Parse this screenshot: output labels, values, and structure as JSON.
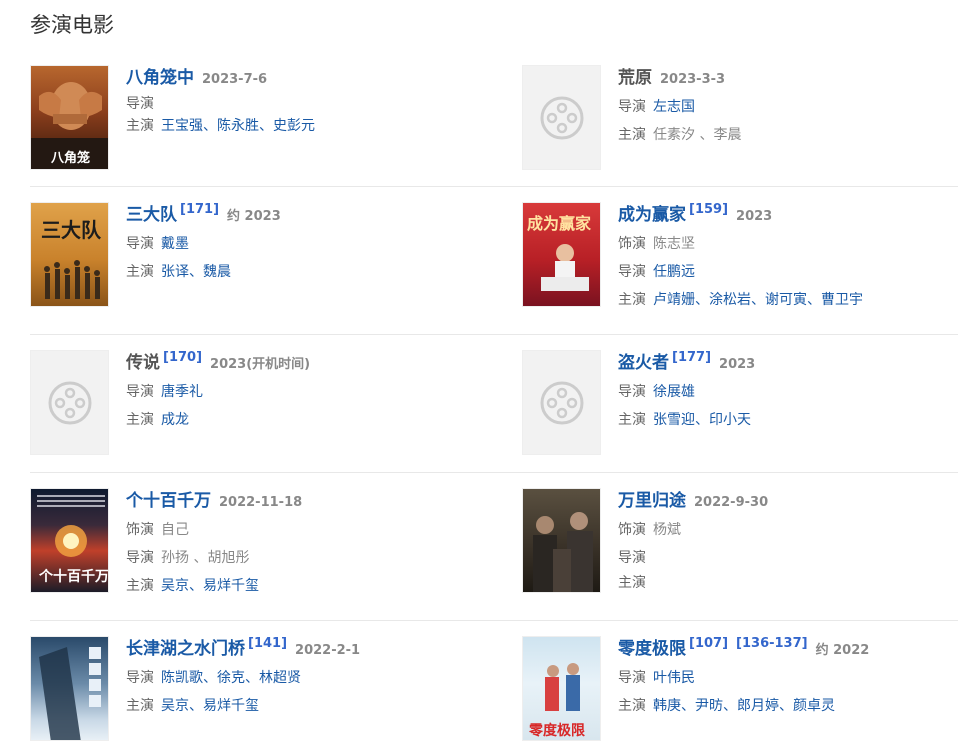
{
  "section_title": "参演电影",
  "movies": [
    {
      "title": "八角笼中",
      "refs": [],
      "date": "2023-7-6",
      "roles": [
        {
          "label": "导演",
          "people": []
        },
        {
          "label": "主演",
          "people": [
            "王宝强",
            "陈永胜",
            "史彭元"
          ]
        }
      ],
      "poster": "poster-bajiaolongzhong"
    },
    {
      "title": "荒原",
      "refs": [],
      "date": "2023-3-3",
      "roles": [
        {
          "label": "导演",
          "people": [
            "左志国"
          ]
        },
        {
          "label": "主演",
          "people": [
            "任素汐",
            "李晨"
          ]
        }
      ],
      "poster": "placeholder"
    },
    {
      "title": "三大队",
      "refs": [
        "[171]"
      ],
      "date": "约 2023",
      "roles": [
        {
          "label": "导演",
          "people": [
            "戴墨"
          ]
        },
        {
          "label": "主演",
          "people": [
            "张译",
            "魏晨"
          ]
        }
      ],
      "poster": "poster-sandadui"
    },
    {
      "title": "成为赢家",
      "refs": [
        "[159]"
      ],
      "date": "2023",
      "roles": [
        {
          "label": "饰演",
          "people": [
            "陈志坚"
          ]
        },
        {
          "label": "导演",
          "people": [
            "任鹏远"
          ]
        },
        {
          "label": "主演",
          "people": [
            "卢靖姗",
            "涂松岩",
            "谢可寅",
            "曹卫宇"
          ]
        }
      ],
      "poster": "poster-chengweiyingjia"
    },
    {
      "title": "传说",
      "refs": [
        "[170]"
      ],
      "date": "2023(开机时间)",
      "roles": [
        {
          "label": "导演",
          "people": [
            "唐季礼"
          ]
        },
        {
          "label": "主演",
          "people": [
            "成龙"
          ]
        }
      ],
      "poster": "placeholder"
    },
    {
      "title": "盗火者",
      "refs": [
        "[177]"
      ],
      "date": "2023",
      "roles": [
        {
          "label": "导演",
          "people": [
            "徐展雄"
          ]
        },
        {
          "label": "主演",
          "people": [
            "张雪迎",
            "印小天"
          ]
        }
      ],
      "poster": "placeholder"
    },
    {
      "title": "个十百千万",
      "refs": [],
      "date": "2022-11-18",
      "roles": [
        {
          "label": "饰演",
          "people": [
            "自己"
          ]
        },
        {
          "label": "导演",
          "people": [
            "孙扬",
            "胡旭彤"
          ]
        },
        {
          "label": "主演",
          "people": [
            "吴京",
            "易烊千玺"
          ]
        }
      ],
      "poster": "poster-geshibaiqianwan"
    },
    {
      "title": "万里归途",
      "refs": [],
      "date": "2022-9-30",
      "roles": [
        {
          "label": "饰演",
          "people": [
            "杨斌"
          ]
        },
        {
          "label": "导演",
          "people": []
        },
        {
          "label": "主演",
          "people": []
        }
      ],
      "poster": "poster-wanliguitu"
    },
    {
      "title": "长津湖之水门桥",
      "refs": [
        "[141]"
      ],
      "date": "2022-2-1",
      "roles": [
        {
          "label": "导演",
          "people": [
            "陈凯歌",
            "徐克",
            "林超贤"
          ]
        },
        {
          "label": "主演",
          "people": [
            "吴京",
            "易烊千玺"
          ]
        }
      ],
      "poster": "poster-changjinhu"
    },
    {
      "title": "零度极限",
      "refs": [
        "[107]",
        "[136-137]"
      ],
      "date": "约 2022",
      "roles": [
        {
          "label": "导演",
          "people": [
            "叶伟民"
          ]
        },
        {
          "label": "主演",
          "people": [
            "韩庚",
            "尹昉",
            "郎月婷",
            "颜卓灵"
          ]
        }
      ],
      "poster": "poster-lingdujixian"
    }
  ],
  "poster_texts": {
    "sandadui": "三大队",
    "chengweiyingjia": "成为赢家",
    "geshibaiqianwan": "个十百千万",
    "lingdujixian": "零度极限"
  }
}
